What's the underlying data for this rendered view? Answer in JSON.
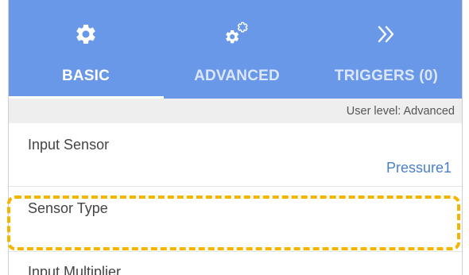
{
  "tabs": [
    {
      "label": "BASIC",
      "icon": "gear-icon",
      "selected": true
    },
    {
      "label": "ADVANCED",
      "icon": "gears-icon",
      "selected": false
    },
    {
      "label": "TRIGGERS (0)",
      "icon": "double-chevron-right-icon",
      "selected": false
    }
  ],
  "user_level": "User level: Advanced",
  "fields": {
    "input_sensor": {
      "label": "Input Sensor",
      "value": "Pressure1"
    },
    "sensor_type": {
      "label": "Sensor Type",
      "value": ""
    },
    "input_multiplier": {
      "label": "Input Multiplier"
    }
  },
  "colors": {
    "tabbar_bg": "#6a98e8",
    "value_text": "#4a7fcc",
    "highlight": "#f5b400",
    "level_strip_bg": "#eeeeee"
  }
}
